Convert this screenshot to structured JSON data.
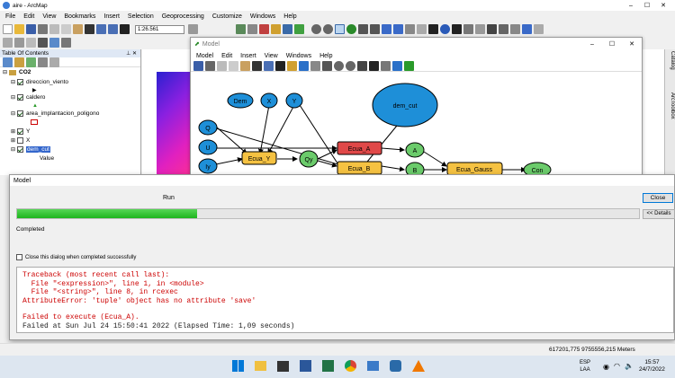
{
  "app": {
    "title": "aire - ArcMap",
    "menu": [
      "File",
      "Edit",
      "View",
      "Bookmarks",
      "Insert",
      "Selection",
      "Geoprocessing",
      "Customize",
      "Windows",
      "Help"
    ],
    "scale": "1:26.561"
  },
  "toc": {
    "title": "Table Of Contents",
    "pin": "p ×",
    "group": "CO2",
    "layers": [
      {
        "name": "direccion_viento",
        "checked": true
      },
      {
        "name": "caldero",
        "checked": true
      },
      {
        "name": "area_implantacion_poligono",
        "checked": true
      },
      {
        "name": "Y",
        "checked": true
      },
      {
        "name": "X",
        "checked": false
      },
      {
        "name": "dem_cut",
        "checked": true,
        "selected": true
      }
    ],
    "value_label": "Value"
  },
  "side_tabs": [
    "Catalog",
    "ArcToolbox"
  ],
  "model_window": {
    "title": "Model",
    "menu": [
      "Model",
      "Edit",
      "Insert",
      "View",
      "Windows",
      "Help"
    ],
    "nodes": {
      "dem": "Dem",
      "x": "X",
      "y": "Y",
      "dem_cut": "dem_cut",
      "q": "Q",
      "u": "U",
      "iy": "Iy",
      "ecua_y": "Ecua_Y",
      "qy": "Qy",
      "ecua_a": "Ecua_A",
      "ecua_b": "Ecua_B",
      "a": "A",
      "b": "B",
      "ecua_gauss": "Ecua_Gauss",
      "con": "Con"
    }
  },
  "dialog": {
    "title": "Model",
    "run_label": "Run",
    "progress": 0.29,
    "status": "Completed",
    "close_label": "Close",
    "details_label": "<< Details",
    "checkbox_label": "Close this dialog when completed successfully",
    "errors": [
      "Traceback (most recent call last):",
      "  File \"<expression>\", line 1, in <module>",
      "  File \"<string>\", line 8, in rcexec",
      "AttributeError: 'tuple' object has no attribute 'save'"
    ],
    "failed1": "Failed to execute (Ecua_A).",
    "failed2": "Failed at Sun Jul 24 15:50:41 2022 (Elapsed Time: 1,09 seconds)"
  },
  "status_bar": {
    "coords": "617201,775  9755556,215 Meters"
  },
  "taskbar": {
    "lang1": "ESP",
    "lang2": "LAA",
    "time": "15:57",
    "date": "24/7/2022"
  },
  "colors": {
    "accent": "#0078d7",
    "progress": "#1db51d",
    "node_blue": "#1e8fd8",
    "node_green": "#6bcb6b",
    "node_yellow": "#f5c242",
    "node_red": "#e04848"
  }
}
